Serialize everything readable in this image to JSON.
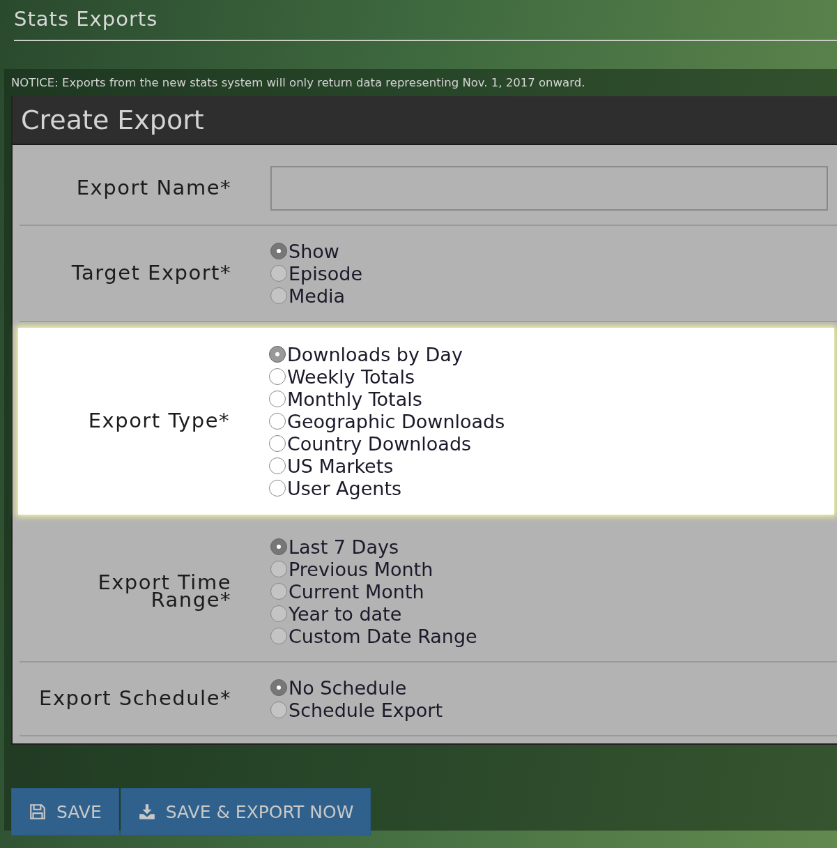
{
  "page_title": "Stats Exports",
  "notice": "NOTICE: Exports from the new stats system will only return data representing Nov. 1, 2017 onward.",
  "form": {
    "title": "Create Export",
    "fields": [
      {
        "kind": "text",
        "label": "Export Name*",
        "highlighted": false
      },
      {
        "kind": "radio",
        "label": "Target Export*",
        "highlighted": false,
        "options": [
          {
            "label": "Show",
            "selected": true
          },
          {
            "label": "Episode",
            "selected": false
          },
          {
            "label": "Media",
            "selected": false
          }
        ]
      },
      {
        "kind": "radio",
        "label": "Export Type*",
        "highlighted": true,
        "options": [
          {
            "label": "Downloads by Day",
            "selected": true
          },
          {
            "label": "Weekly Totals",
            "selected": false
          },
          {
            "label": "Monthly Totals",
            "selected": false
          },
          {
            "label": "Geographic Downloads",
            "selected": false
          },
          {
            "label": "Country Downloads",
            "selected": false
          },
          {
            "label": "US Markets",
            "selected": false
          },
          {
            "label": "User Agents",
            "selected": false
          }
        ]
      },
      {
        "kind": "radio",
        "label": "Export Time Range*",
        "highlighted": false,
        "options": [
          {
            "label": "Last 7 Days",
            "selected": true
          },
          {
            "label": "Previous Month",
            "selected": false
          },
          {
            "label": "Current Month",
            "selected": false
          },
          {
            "label": "Year to date",
            "selected": false
          },
          {
            "label": "Custom Date Range",
            "selected": false
          }
        ]
      },
      {
        "kind": "radio",
        "label": "Export Schedule*",
        "highlighted": false,
        "options": [
          {
            "label": "No Schedule",
            "selected": true
          },
          {
            "label": "Schedule Export",
            "selected": false
          }
        ]
      }
    ]
  },
  "buttons": [
    {
      "kind": "save",
      "label": "SAVE"
    },
    {
      "kind": "export",
      "label": "SAVE & EXPORT NOW"
    }
  ]
}
